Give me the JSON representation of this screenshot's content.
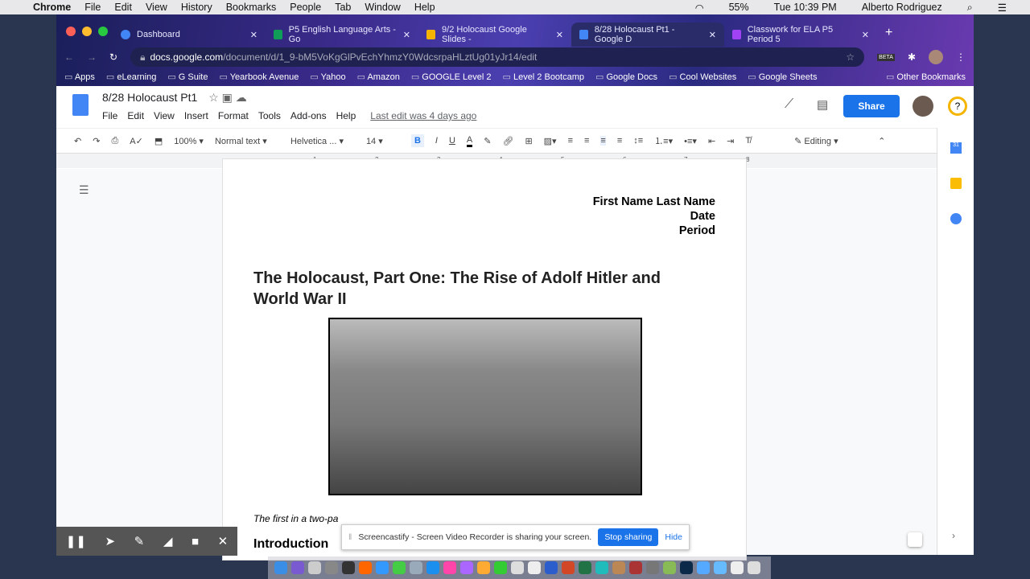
{
  "mac_menu": {
    "app": "Chrome",
    "items": [
      "File",
      "Edit",
      "View",
      "History",
      "Bookmarks",
      "People",
      "Tab",
      "Window",
      "Help"
    ],
    "battery": "55%",
    "clock": "Tue 10:39 PM",
    "user": "Alberto Rodriguez"
  },
  "tabs": [
    {
      "label": "Dashboard",
      "color": "#4285f4"
    },
    {
      "label": "P5 English Language Arts - Go",
      "color": "#0f9d58"
    },
    {
      "label": "9/2 Holocaust Google Slides -",
      "color": "#f4b400"
    },
    {
      "label": "8/28 Holocaust Pt1 - Google D",
      "color": "#4285f4",
      "active": true
    },
    {
      "label": "Classwork for ELA P5 Period 5",
      "color": "#a142f4"
    }
  ],
  "address": {
    "domain": "docs.google.com",
    "path": "/document/d/1_9-bM5VoKgGlPvEchYhmzY0WdcsrpaHLztUg01yJr14/edit",
    "beta": "BETA"
  },
  "bookmarks": [
    "Apps",
    "eLearning",
    "G Suite",
    "Yearbook Avenue",
    "Yahoo",
    "Amazon",
    "GOOGLE Level 2",
    "Level 2 Bootcamp",
    "Google Docs",
    "Cool Websites",
    "Google Sheets"
  ],
  "other_bookmarks": "Other Bookmarks",
  "doc": {
    "title": "8/28 Holocaust Pt1",
    "menu": [
      "File",
      "Edit",
      "View",
      "Insert",
      "Format",
      "Tools",
      "Add-ons",
      "Help"
    ],
    "last_edit": "Last edit was 4 days ago",
    "share": "Share"
  },
  "toolbar": {
    "zoom": "100%",
    "style": "Normal text",
    "font": "Helvetica ...",
    "size": "14",
    "mode": "Editing"
  },
  "ruler": [
    "1",
    "2",
    "3",
    "4",
    "5",
    "6",
    "7",
    "8"
  ],
  "page": {
    "header_lines": [
      "First Name Last Name",
      "Date",
      "Period"
    ],
    "heading": "The Holocaust, Part One: The Rise of Adolf Hitler and World War II",
    "intro": "The first in a two-pa",
    "section": "Introduction"
  },
  "sharing_bar": {
    "message": "Screencastify - Screen Video Recorder is sharing your screen.",
    "stop": "Stop sharing",
    "hide": "Hide"
  },
  "accent": "#1a73e8"
}
